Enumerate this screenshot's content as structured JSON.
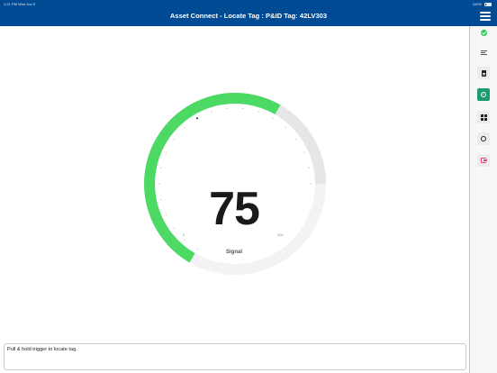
{
  "status_bar": {
    "left": "1:21 PM   Wed Jun 9",
    "right": "100%"
  },
  "header": {
    "title": "Asset Connect - Locate Tag : P&ID Tag: 42LV303"
  },
  "gauge": {
    "value": 75,
    "value_text": "75",
    "min": 0,
    "max": 100,
    "min_label": "0",
    "max_label": "100",
    "label": "Signal",
    "colors": {
      "fill": "#4cd964",
      "track": "#e6e6e9",
      "inner_track": "#f3f3f5",
      "tick": "#9a9a9a",
      "text": "#1a1a1a"
    }
  },
  "message": {
    "text": "Pull & hold trigger to locate tag."
  },
  "sidebar": {
    "items": [
      {
        "name": "connection-status",
        "icon": "check-circle-icon",
        "active": false
      },
      {
        "name": "tags",
        "icon": "tags-icon",
        "active": false
      },
      {
        "name": "document",
        "icon": "document-icon",
        "active": false
      },
      {
        "name": "locate",
        "icon": "locate-icon",
        "active": true
      },
      {
        "name": "dashboard",
        "icon": "grid-icon",
        "active": false
      },
      {
        "name": "settings",
        "icon": "gear-icon",
        "active": false
      },
      {
        "name": "logout",
        "icon": "logout-icon",
        "active": false
      }
    ],
    "accent": "#1f9b74"
  },
  "colors": {
    "header_bg": "#004b93",
    "sidebar_bg": "#f7f7f7"
  }
}
